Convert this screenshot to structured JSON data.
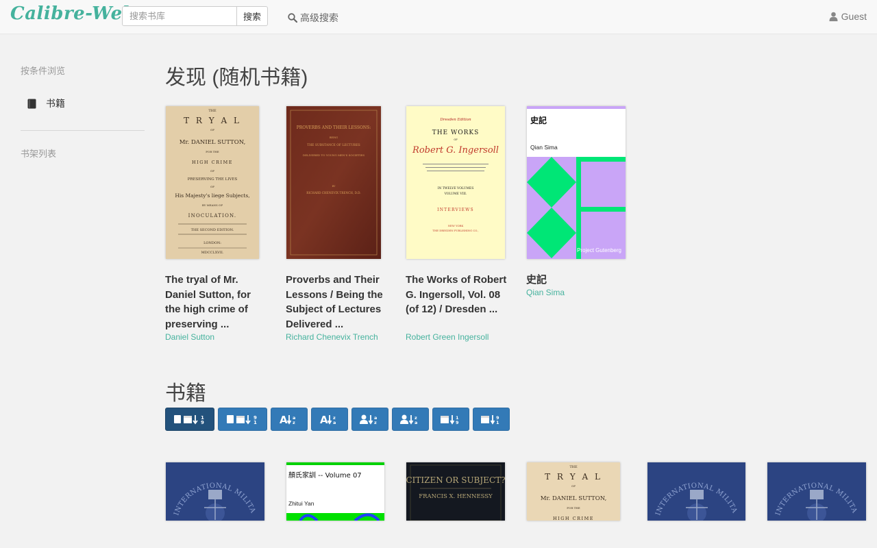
{
  "navbar": {
    "brand": "Calibre-Web",
    "search_placeholder": "搜索书库",
    "search_button": "搜索",
    "advanced_search": "高级搜索",
    "user": "Guest"
  },
  "sidebar": {
    "browse_heading": "按条件浏览",
    "books_label": "书籍",
    "shelves_heading": "书架列表"
  },
  "discover": {
    "title": "发现 (随机书籍)",
    "books": [
      {
        "title": "The tryal of Mr. Daniel Sutton, for the high crime of preserving ...",
        "author": "Daniel Sutton"
      },
      {
        "title": "Proverbs and Their Lessons / Being the Subject of Lectures Delivered ...",
        "author": "Richard Chenevix Trench"
      },
      {
        "title": "The Works of Robert G. Ingersoll, Vol. 08 (of 12) / Dresden ...",
        "author": "Robert Green Ingersoll"
      },
      {
        "title": "史記",
        "author": "Qian Sima"
      }
    ]
  },
  "covers": {
    "tryal": {
      "l1": "THE",
      "l2": "T R Y A L",
      "l3": "OF",
      "l4": "Mr. DANIEL SUTTON,",
      "l5": "FOR THE",
      "l6": "HIGH CRIME",
      "l7": "OF",
      "l8": "PRESERVING THE LIVES",
      "l9": "OF",
      "l10": "His Majesty's liege Subjects,",
      "l11": "BY MEANS OF",
      "l12": "INOCULATION.",
      "l13": "THE SECOND EDITION.",
      "l14": "LONDON:",
      "l15": "MDCCLXVII."
    },
    "proverbs": {
      "l1": "PROVERBS AND THEIR LESSONS:",
      "l2": "BEING",
      "l3": "THE SUBSTANCE OF LECTURES",
      "l4": "DELIVERED TO YOUNG MEN'S SOCIETIES",
      "l5": "BY",
      "l6": "RICHARD CHENEVIX TRENCH, D.D."
    },
    "ingersoll": {
      "l1": "Dresden Edition",
      "l2": "THE WORKS",
      "l3": "OF",
      "l4": "Robert G. Ingersoll",
      "l5": "IN TWELVE VOLUMES",
      "l6": "VOLUME VIII.",
      "l7": "INTERVIEWS",
      "l8": "NEW YORK",
      "l9": "THE DRESDEN PUBLISHING CO.,"
    },
    "shiji": {
      "title": "史記",
      "author": "Qian Sima",
      "publisher": "Project Gutenberg"
    },
    "military": {
      "arc": "INTERNATIONAL MILITARY TRIBU"
    },
    "yan": {
      "title": "顏氏家訓 -- Volume 07",
      "author": "Zhitui Yan"
    },
    "citizen": {
      "title": "CITIZEN OR SUBJECT?",
      "author": "FRANCIS X. HENNESSY"
    }
  },
  "books_section": {
    "title": "书籍",
    "sort_buttons": [
      "book-date-desc",
      "book-date-asc",
      "title-asc",
      "title-desc",
      "author-asc",
      "author-desc",
      "pubdate-asc",
      "pubdate-desc"
    ]
  },
  "colors": {
    "accent": "#45b29d",
    "button": "#337ab7",
    "button_active": "#23527c",
    "shiji_purple": "#c9a5f7",
    "shiji_green": "#00e676"
  }
}
